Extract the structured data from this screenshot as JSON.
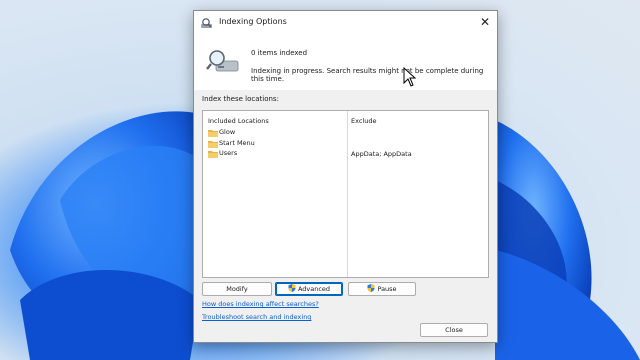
{
  "window": {
    "title": "Indexing Options",
    "close_glyph": "✕"
  },
  "status": {
    "items_indexed": "0 items indexed",
    "message": "Indexing in progress. Search results might not be complete during this time."
  },
  "locations": {
    "section_label": "Index these locations:",
    "columns": [
      "Included Locations",
      "Exclude"
    ],
    "rows": [
      {
        "name": "Glow",
        "exclude": ""
      },
      {
        "name": "Start Menu",
        "exclude": ""
      },
      {
        "name": "Users",
        "exclude": "AppData; AppData"
      }
    ]
  },
  "buttons": {
    "modify": "Modify",
    "advanced": "Advanced",
    "pause": "Pause",
    "close": "Close"
  },
  "links": {
    "how_affects": "How does indexing affect searches?",
    "troubleshoot": "Troubleshoot search and indexing"
  },
  "icons": {
    "title": "indexing-options-icon",
    "header": "magnifier-drive-icon",
    "folder": "folder-icon",
    "shield": "uac-shield-icon",
    "cursor": "mouse-pointer-icon"
  },
  "colors": {
    "accent": "#0067c0",
    "link": "#0b5ecf",
    "folder": "#e8b64a",
    "wallpaper_blue": "#1a63e8"
  }
}
